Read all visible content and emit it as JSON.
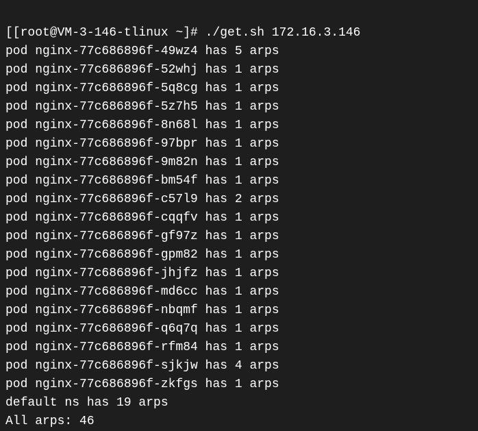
{
  "prompt": "[[root@VM-3-146-tlinux ~]# ./get.sh 172.16.3.146",
  "lines": [
    "pod nginx-77c686896f-49wz4 has 5 arps",
    "pod nginx-77c686896f-52whj has 1 arps",
    "pod nginx-77c686896f-5q8cg has 1 arps",
    "pod nginx-77c686896f-5z7h5 has 1 arps",
    "pod nginx-77c686896f-8n68l has 1 arps",
    "pod nginx-77c686896f-97bpr has 1 arps",
    "pod nginx-77c686896f-9m82n has 1 arps",
    "pod nginx-77c686896f-bm54f has 1 arps",
    "pod nginx-77c686896f-c57l9 has 2 arps",
    "pod nginx-77c686896f-cqqfv has 1 arps",
    "pod nginx-77c686896f-gf97z has 1 arps",
    "pod nginx-77c686896f-gpm82 has 1 arps",
    "pod nginx-77c686896f-jhjfz has 1 arps",
    "pod nginx-77c686896f-md6cc has 1 arps",
    "pod nginx-77c686896f-nbqmf has 1 arps",
    "pod nginx-77c686896f-q6q7q has 1 arps",
    "pod nginx-77c686896f-rfm84 has 1 arps",
    "pod nginx-77c686896f-sjkjw has 4 arps",
    "pod nginx-77c686896f-zkfgs has 1 arps",
    "default ns has 19 arps",
    "All arps: 46"
  ]
}
